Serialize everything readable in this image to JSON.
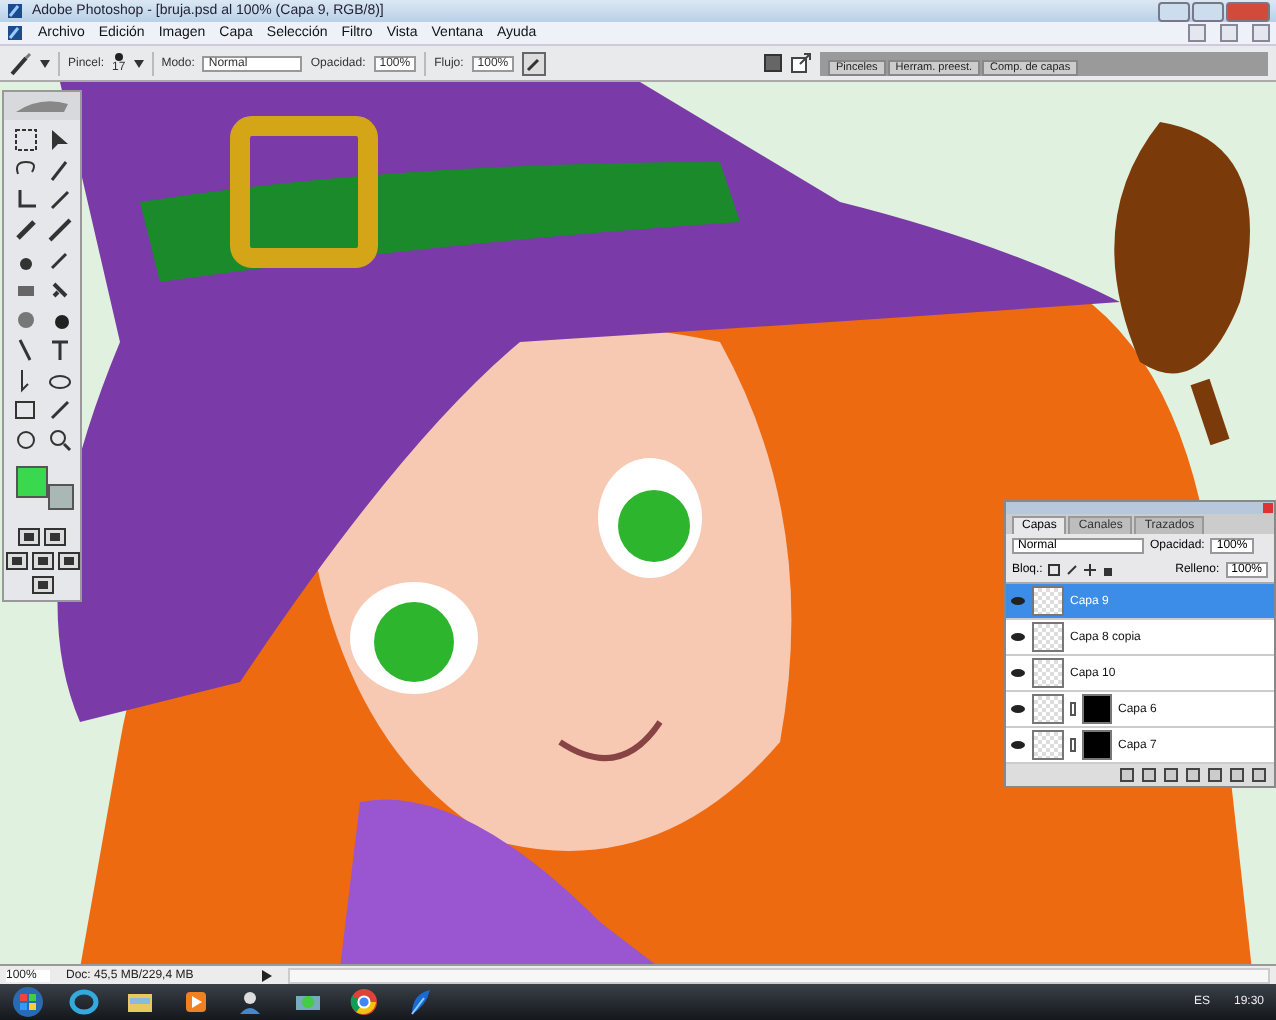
{
  "window": {
    "title": "Adobe Photoshop - [bruja.psd al 100% (Capa 9, RGB/8)]"
  },
  "menu": [
    "Archivo",
    "Edición",
    "Imagen",
    "Capa",
    "Selección",
    "Filtro",
    "Vista",
    "Ventana",
    "Ayuda"
  ],
  "options_bar": {
    "brush_label": "Pincel:",
    "brush_size": "17",
    "mode_label": "Modo:",
    "mode": "Normal",
    "opacity_label": "Opacidad:",
    "opacity": "100%",
    "flow_label": "Flujo:",
    "flow": "100%"
  },
  "palette_well": [
    {
      "label": "Pinceles"
    },
    {
      "label": "Herram. preest."
    },
    {
      "label": "Comp. de capas"
    }
  ],
  "layers_panel": {
    "tabs": [
      {
        "label": "Capas",
        "selected": true
      },
      {
        "label": "Canales",
        "selected": false
      },
      {
        "label": "Trazados",
        "selected": false
      }
    ],
    "blend_mode": "Normal",
    "opacity_label": "Opacidad:",
    "opacity": "100%",
    "lock_label": "Bloq.:",
    "fill_label": "Relleno:",
    "fill": "100%",
    "layers": [
      {
        "name": "Capa 9",
        "selected": true,
        "visible": true,
        "kind": "plain"
      },
      {
        "name": "Capa 8 copia",
        "selected": false,
        "visible": true,
        "kind": "plain"
      },
      {
        "name": "Capa 10",
        "selected": false,
        "visible": true,
        "kind": "plain"
      },
      {
        "name": "Capa 6",
        "selected": false,
        "visible": true,
        "kind": "masked"
      },
      {
        "name": "Capa 7",
        "selected": false,
        "visible": true,
        "kind": "masked"
      }
    ]
  },
  "status_bar": {
    "zoom": "100%",
    "doc": "Doc: 45,5 MB/229,4 MB"
  },
  "taskbar": {
    "language": "ES",
    "time": "19:30"
  }
}
